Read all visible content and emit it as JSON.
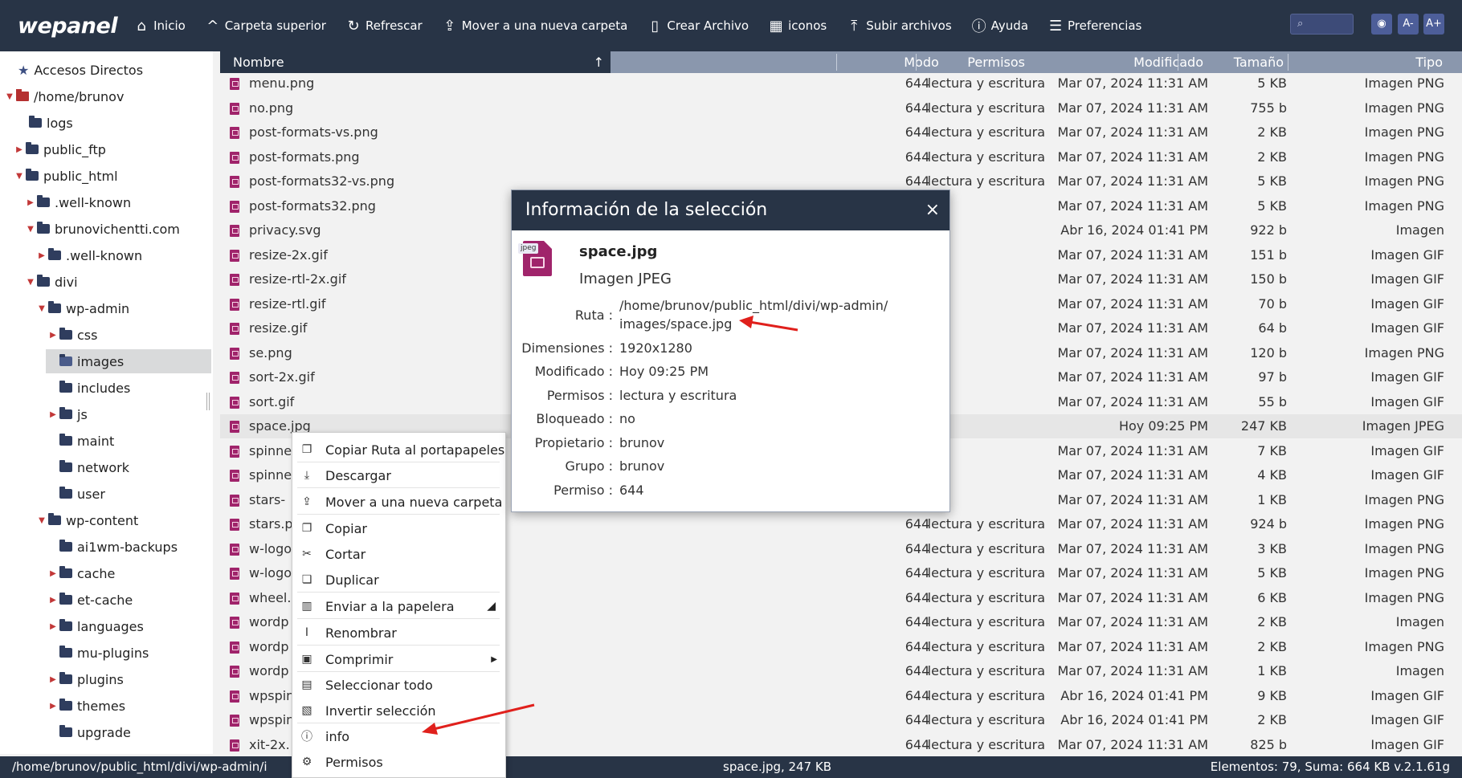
{
  "toolbar": {
    "logo": "wepanel",
    "items": [
      {
        "label": "Inicio"
      },
      {
        "label": "Carpeta superior"
      },
      {
        "label": "Refrescar"
      },
      {
        "label": "Mover a una nueva carpeta"
      },
      {
        "label": "Crear Archivo"
      },
      {
        "label": "iconos"
      },
      {
        "label": "Subir archivos"
      },
      {
        "label": "Ayuda"
      },
      {
        "label": "Preferencias"
      }
    ],
    "font_minus": "A-",
    "font_plus": "A+"
  },
  "sidebar": {
    "items": [
      {
        "label": "Accesos Directos"
      },
      {
        "label": "/home/brunov"
      },
      {
        "label": "logs"
      },
      {
        "label": "public_ftp"
      },
      {
        "label": "public_html"
      },
      {
        "label": ".well-known"
      },
      {
        "label": "brunovichentti.com"
      },
      {
        "label": ".well-known"
      },
      {
        "label": "divi"
      },
      {
        "label": "wp-admin"
      },
      {
        "label": "css"
      },
      {
        "label": "images"
      },
      {
        "label": "includes"
      },
      {
        "label": "js"
      },
      {
        "label": "maint"
      },
      {
        "label": "network"
      },
      {
        "label": "user"
      },
      {
        "label": "wp-content"
      },
      {
        "label": "ai1wm-backups"
      },
      {
        "label": "cache"
      },
      {
        "label": "et-cache"
      },
      {
        "label": "languages"
      },
      {
        "label": "mu-plugins"
      },
      {
        "label": "plugins"
      },
      {
        "label": "themes"
      },
      {
        "label": "upgrade"
      }
    ]
  },
  "table": {
    "headers": {
      "name": "Nombre",
      "perms": "Permisos",
      "mode": "Modo",
      "modified": "Modificado",
      "size": "Tamaño",
      "type": "Tipo"
    },
    "rows": [
      {
        "name": "menu.png",
        "perms": "lectura y escritura",
        "mode": "644",
        "modified": "Mar 07, 2024 11:31 AM",
        "size": "5 KB",
        "type": "Imagen PNG"
      },
      {
        "name": "no.png",
        "perms": "lectura y escritura",
        "mode": "644",
        "modified": "Mar 07, 2024 11:31 AM",
        "size": "755 b",
        "type": "Imagen PNG"
      },
      {
        "name": "post-formats-vs.png",
        "perms": "lectura y escritura",
        "mode": "644",
        "modified": "Mar 07, 2024 11:31 AM",
        "size": "2 KB",
        "type": "Imagen PNG"
      },
      {
        "name": "post-formats.png",
        "perms": "lectura y escritura",
        "mode": "644",
        "modified": "Mar 07, 2024 11:31 AM",
        "size": "2 KB",
        "type": "Imagen PNG"
      },
      {
        "name": "post-formats32-vs.png",
        "perms": "lectura y escritura",
        "mode": "644",
        "modified": "Mar 07, 2024 11:31 AM",
        "size": "5 KB",
        "type": "Imagen PNG"
      },
      {
        "name": "post-formats32.png",
        "perms": "",
        "mode": "",
        "modified": "Mar 07, 2024 11:31 AM",
        "size": "5 KB",
        "type": "Imagen PNG"
      },
      {
        "name": "privacy.svg",
        "perms": "",
        "mode": "",
        "modified": "Abr 16, 2024 01:41 PM",
        "size": "922 b",
        "type": "Imagen"
      },
      {
        "name": "resize-2x.gif",
        "perms": "",
        "mode": "",
        "modified": "Mar 07, 2024 11:31 AM",
        "size": "151 b",
        "type": "Imagen GIF"
      },
      {
        "name": "resize-rtl-2x.gif",
        "perms": "",
        "mode": "",
        "modified": "Mar 07, 2024 11:31 AM",
        "size": "150 b",
        "type": "Imagen GIF"
      },
      {
        "name": "resize-rtl.gif",
        "perms": "",
        "mode": "",
        "modified": "Mar 07, 2024 11:31 AM",
        "size": "70 b",
        "type": "Imagen GIF"
      },
      {
        "name": "resize.gif",
        "perms": "",
        "mode": "",
        "modified": "Mar 07, 2024 11:31 AM",
        "size": "64 b",
        "type": "Imagen GIF"
      },
      {
        "name": "se.png",
        "perms": "",
        "mode": "",
        "modified": "Mar 07, 2024 11:31 AM",
        "size": "120 b",
        "type": "Imagen PNG"
      },
      {
        "name": "sort-2x.gif",
        "perms": "",
        "mode": "",
        "modified": "Mar 07, 2024 11:31 AM",
        "size": "97 b",
        "type": "Imagen GIF"
      },
      {
        "name": "sort.gif",
        "perms": "",
        "mode": "",
        "modified": "Mar 07, 2024 11:31 AM",
        "size": "55 b",
        "type": "Imagen GIF"
      },
      {
        "name": "space.jpg",
        "perms": "",
        "mode": "",
        "modified": "Hoy 09:25 PM",
        "size": "247 KB",
        "type": "Imagen JPEG"
      },
      {
        "name": "spinne",
        "perms": "",
        "mode": "",
        "modified": "Mar 07, 2024 11:31 AM",
        "size": "7 KB",
        "type": "Imagen GIF"
      },
      {
        "name": "spinne",
        "perms": "",
        "mode": "",
        "modified": "Mar 07, 2024 11:31 AM",
        "size": "4 KB",
        "type": "Imagen GIF"
      },
      {
        "name": "stars-",
        "perms": "",
        "mode": "",
        "modified": "Mar 07, 2024 11:31 AM",
        "size": "1 KB",
        "type": "Imagen PNG"
      },
      {
        "name": "stars.p",
        "perms": "lectura y escritura",
        "mode": "644",
        "modified": "Mar 07, 2024 11:31 AM",
        "size": "924 b",
        "type": "Imagen PNG"
      },
      {
        "name": "w-logo",
        "perms": "lectura y escritura",
        "mode": "644",
        "modified": "Mar 07, 2024 11:31 AM",
        "size": "3 KB",
        "type": "Imagen PNG"
      },
      {
        "name": "w-logo",
        "perms": "lectura y escritura",
        "mode": "644",
        "modified": "Mar 07, 2024 11:31 AM",
        "size": "5 KB",
        "type": "Imagen PNG"
      },
      {
        "name": "wheel.",
        "perms": "lectura y escritura",
        "mode": "644",
        "modified": "Mar 07, 2024 11:31 AM",
        "size": "6 KB",
        "type": "Imagen PNG"
      },
      {
        "name": "wordp",
        "perms": "lectura y escritura",
        "mode": "644",
        "modified": "Mar 07, 2024 11:31 AM",
        "size": "2 KB",
        "type": "Imagen"
      },
      {
        "name": "wordp",
        "perms": "lectura y escritura",
        "mode": "644",
        "modified": "Mar 07, 2024 11:31 AM",
        "size": "2 KB",
        "type": "Imagen PNG"
      },
      {
        "name": "wordp",
        "perms": "lectura y escritura",
        "mode": "644",
        "modified": "Mar 07, 2024 11:31 AM",
        "size": "1 KB",
        "type": "Imagen"
      },
      {
        "name": "wpspin",
        "perms": "lectura y escritura",
        "mode": "644",
        "modified": "Abr 16, 2024 01:41 PM",
        "size": "9 KB",
        "type": "Imagen GIF"
      },
      {
        "name": "wpspin",
        "perms": "lectura y escritura",
        "mode": "644",
        "modified": "Abr 16, 2024 01:41 PM",
        "size": "2 KB",
        "type": "Imagen GIF"
      },
      {
        "name": "xit-2x.",
        "perms": "lectura y escritura",
        "mode": "644",
        "modified": "Mar 07, 2024 11:31 AM",
        "size": "825 b",
        "type": "Imagen GIF"
      }
    ]
  },
  "context_menu": {
    "items": [
      {
        "label": "Copiar Ruta al portapapeles"
      },
      {
        "label": "Descargar"
      },
      {
        "label": "Mover a una nueva carpeta"
      },
      {
        "label": "Copiar"
      },
      {
        "label": "Cortar"
      },
      {
        "label": "Duplicar"
      },
      {
        "label": "Enviar a la papelera"
      },
      {
        "label": "Renombrar"
      },
      {
        "label": "Comprimir"
      },
      {
        "label": "Seleccionar todo"
      },
      {
        "label": "Invertir selección"
      },
      {
        "label": "info"
      },
      {
        "label": "Permisos"
      }
    ]
  },
  "dialog": {
    "title": "Información de la selección",
    "close": "×",
    "icon_badge": "jpeg",
    "file_name": "space.jpg",
    "file_type": "Imagen JPEG",
    "fields": [
      {
        "label": "Ruta :",
        "value": "/home/brunov/public_html/divi/wp-admin/",
        "value2": "images/space.jpg"
      },
      {
        "label": "Dimensiones :",
        "value": "1920x1280"
      },
      {
        "label": "Modificado :",
        "value": "Hoy 09:25 PM"
      },
      {
        "label": "Permisos :",
        "value": "lectura y escritura"
      },
      {
        "label": "Bloqueado :",
        "value": "no"
      },
      {
        "label": "Propietario :",
        "value": "brunov"
      },
      {
        "label": "Grupo :",
        "value": "brunov"
      },
      {
        "label": "Permiso :",
        "value": "644"
      }
    ]
  },
  "status": {
    "path": "/home/brunov/public_html/divi/wp-admin/i",
    "selection": "space.jpg, 247 KB",
    "summary": "Elementos: 79, Suma: 664 KB v.2.1.61g"
  },
  "colors": {
    "toolbar_bg": "#283446",
    "file_icon": "#a0246b",
    "annotation_arrow": "#e0201c"
  }
}
